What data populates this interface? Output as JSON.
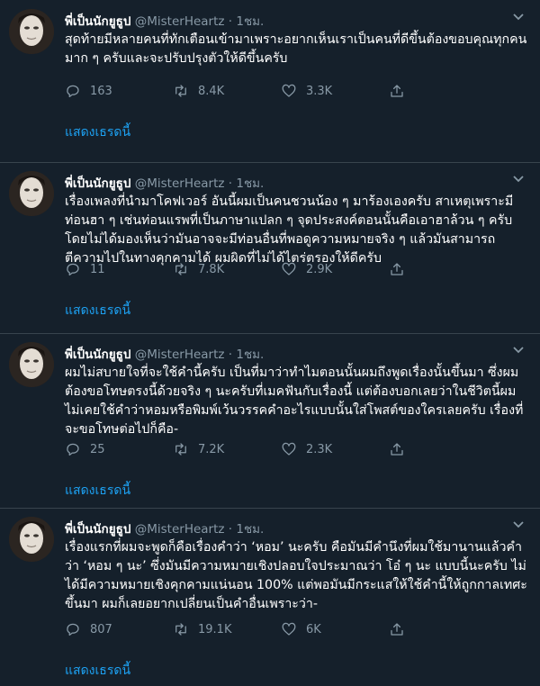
{
  "colors": {
    "background": "#15202b",
    "text": "#ffffff",
    "muted": "#8899a6",
    "link": "#1da1f2",
    "divider": "#38444d"
  },
  "tweets": [
    {
      "name": "พี่เป็นนักยูธูป",
      "handle": "@MisterHeartz",
      "dot": "·",
      "time": "1ชม.",
      "text": "สุดท้ายมีหลายคนที่ทักเตือนเข้ามาเพราะอยากเห็นเราเป็นคนที่ดีขึ้นต้องขอบคุณทุกคนมาก ๆ ครับและจะปรับปรุงตัวให้ดีขึ้นครับ",
      "replies": "163",
      "retweets": "8.4K",
      "likes": "3.3K",
      "thread_link": "แสดงเธรดนี้"
    },
    {
      "name": "พี่เป็นนักยูธูป",
      "handle": "@MisterHeartz",
      "dot": "·",
      "time": "1ชม.",
      "text": "เรื่องเพลงที่นำมาโคฟเวอร์ อันนี้ผมเป็นคนชวนน้อง ๆ มาร้องเองครับ สาเหตุเพราะมีท่อนฮา ๆ เช่นท่อนแรพที่เป็นภาษาแปลก ๆ จุดประสงค์ตอนนั้นคือเอาฮาล้วน ๆ ครับ โดยไม่ได้มองเห็นว่ามันอาจจะมีท่อนอื่นที่พอดูความหมายจริง ๆ แล้วมันสามารถตีความไปในทางคุกคามได้ ผมผิดที่ไม่ได้ไตร่ตรองให้ดีครับ",
      "replies": "11",
      "retweets": "7.8K",
      "likes": "2.9K",
      "thread_link": "แสดงเธรดนี้"
    },
    {
      "name": "พี่เป็นนักยูธูป",
      "handle": "@MisterHeartz",
      "dot": "·",
      "time": "1ชม.",
      "text": "ผมไม่สบายใจที่จะใช้คำนี้ครับ เป็นที่มาว่าทำไมตอนนั้นผมถึงพูดเรื่องนั้นขึ้นมา ซึ่งผมต้องขอโทษตรงนี้ด้วยจริง ๆ นะครับที่เมคฟันกับเรื่องนี้ แต่ต้องบอกเลยว่าในชีวิตนี้ผมไม่เคยใช้คำว่าหอมหรือพิมพ์เว้นวรรคคำอะไรแบบนั้นใส่โพสต์ของใครเลยครับ เรื่องที่จะขอโทษต่อไปก็คือ-",
      "replies": "25",
      "retweets": "7.2K",
      "likes": "2.3K",
      "thread_link": "แสดงเธรดนี้"
    },
    {
      "name": "พี่เป็นนักยูธูป",
      "handle": "@MisterHeartz",
      "dot": "·",
      "time": "1ชม.",
      "text": "เรื่องแรกที่ผมจะพูดก็คือเรื่องคำว่า ‘หอม’ นะครับ คือมันมีคำนึงที่ผมใช้มานานแล้วคำว่า ‘หอม ๆ นะ’ ซึ่งมันมีความหมายเชิงปลอบใจประมาณว่า โอ๋ ๆ นะ แบบนี้นะครับ ไม่ได้มีความหมายเชิงคุกคามแน่นอน 100% แต่พอมันมีกระแสให้ใช้คำนี้ให้ถูกกาลเทศะขึ้นมา ผมก็เลยอยากเปลี่ยนเป็นคำอื่นเพราะว่า-",
      "replies": "807",
      "retweets": "19.1K",
      "likes": "6K",
      "thread_link": "แสดงเธรดนี้"
    }
  ]
}
